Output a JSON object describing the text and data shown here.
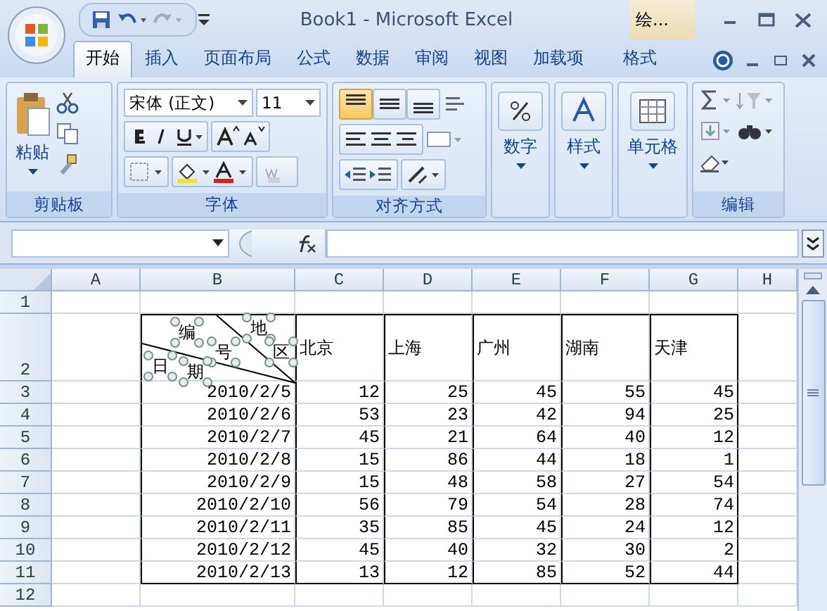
{
  "window": {
    "title": "Book1 - Microsoft Excel",
    "context_tab": "绘..."
  },
  "tabs": [
    {
      "label": "开始",
      "selected": true
    },
    {
      "label": "插入",
      "selected": false
    },
    {
      "label": "页面布局",
      "selected": false
    },
    {
      "label": "公式",
      "selected": false
    },
    {
      "label": "数据",
      "selected": false
    },
    {
      "label": "审阅",
      "selected": false
    },
    {
      "label": "视图",
      "selected": false
    },
    {
      "label": "加载项",
      "selected": false
    },
    {
      "label": "格式",
      "selected": false
    }
  ],
  "ribbon": {
    "paste": "粘贴",
    "font_name": "宋体 (正文)",
    "font_size": "11",
    "vertical_align": [
      {
        "selected": true
      },
      {
        "selected": false
      },
      {
        "selected": false
      }
    ],
    "big_buttons": [
      "数字",
      "样式",
      "单元格"
    ],
    "group_labels": [
      "剪贴板",
      "字体",
      "对齐方式",
      "编辑"
    ]
  },
  "sheet": {
    "column_letters": [
      "A",
      "B",
      "C",
      "D",
      "E",
      "F",
      "G",
      "H"
    ],
    "row_numbers": [
      "1",
      "2",
      "3",
      "4",
      "5",
      "6",
      "7",
      "8",
      "9",
      "10",
      "11",
      "12"
    ],
    "diagonal_labels": [
      "编",
      "号",
      "地",
      "区",
      "日",
      "期"
    ],
    "cities": [
      "北京",
      "上海",
      "广州",
      "湖南",
      "天津"
    ],
    "records": [
      [
        "2010/2/5",
        "12",
        "25",
        "45",
        "55",
        "45"
      ],
      [
        "2010/2/6",
        "53",
        "23",
        "42",
        "94",
        "25"
      ],
      [
        "2010/2/7",
        "45",
        "21",
        "64",
        "40",
        "12"
      ],
      [
        "2010/2/8",
        "15",
        "86",
        "44",
        "18",
        "1"
      ],
      [
        "2010/2/9",
        "15",
        "48",
        "58",
        "27",
        "54"
      ],
      [
        "2010/2/10",
        "56",
        "79",
        "54",
        "28",
        "74"
      ],
      [
        "2010/2/11",
        "35",
        "85",
        "45",
        "24",
        "12"
      ],
      [
        "2010/2/12",
        "45",
        "40",
        "32",
        "30",
        "2"
      ],
      [
        "2010/2/13",
        "13",
        "12",
        "85",
        "52",
        "44"
      ]
    ]
  }
}
